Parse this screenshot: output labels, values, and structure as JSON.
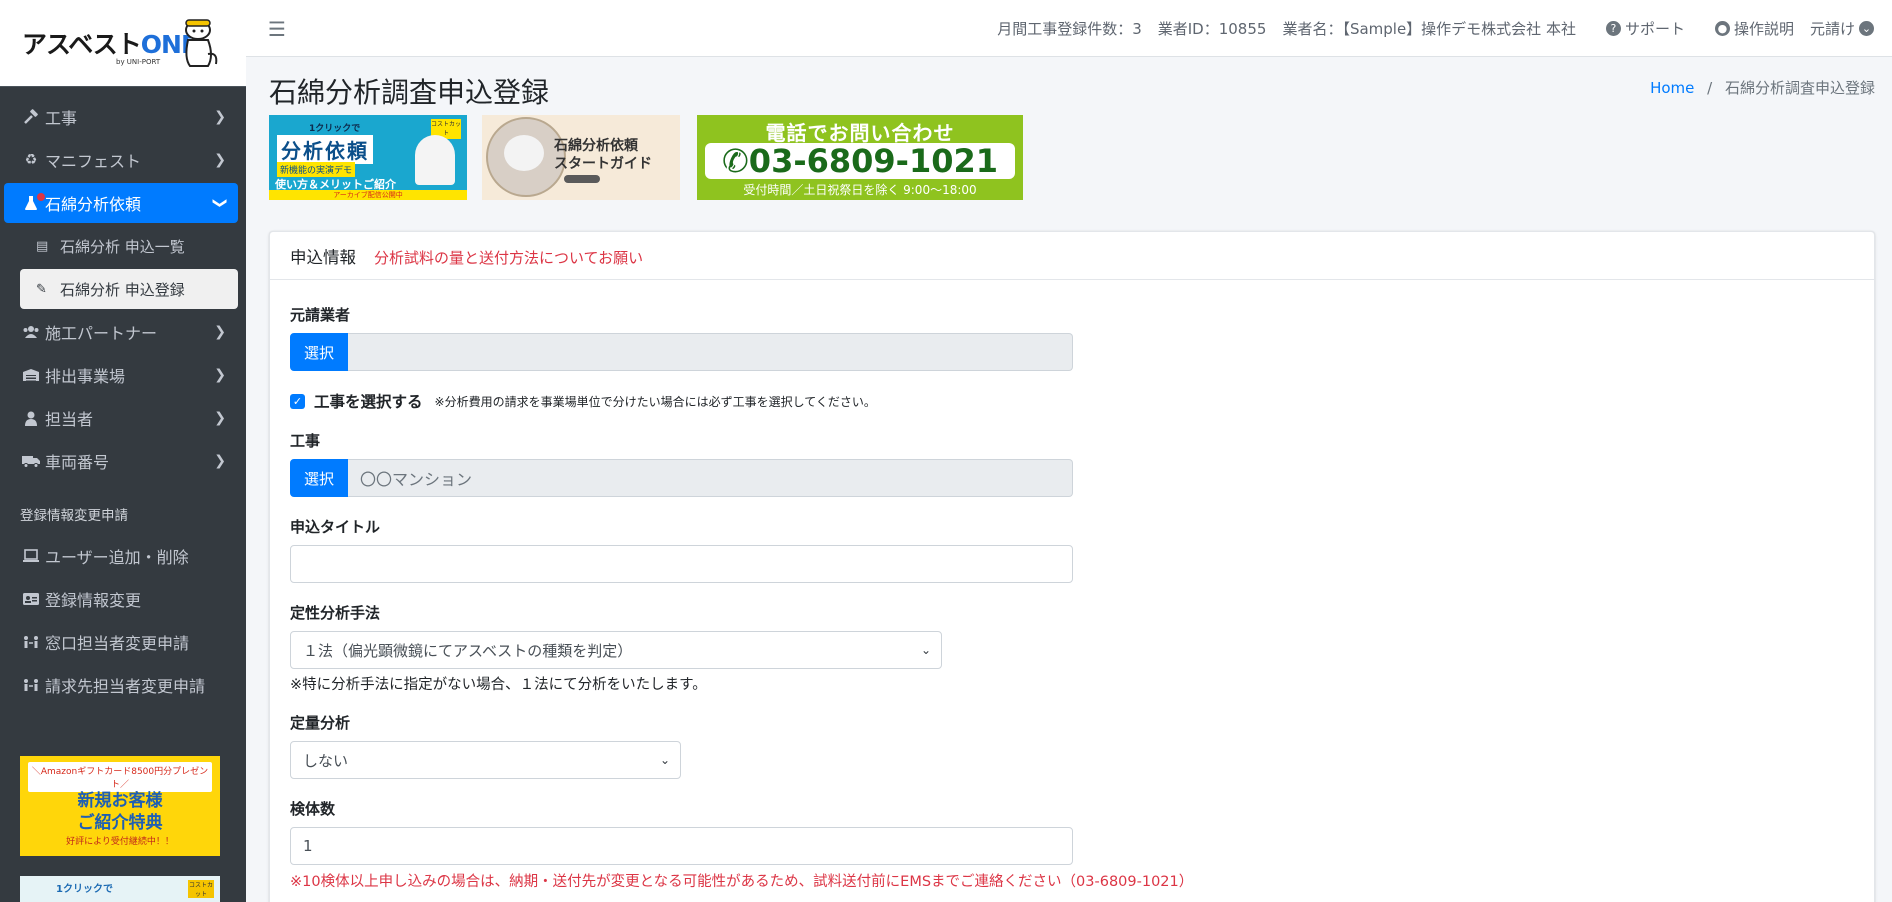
{
  "brand": {
    "name_a": "アスベスト",
    "name_b": "ONE",
    "byline": "by UNI-PORT"
  },
  "sidebar": {
    "items": [
      {
        "label": "工事",
        "icon": "hammer-icon"
      },
      {
        "label": "マニフェスト",
        "icon": "recycle-icon"
      },
      {
        "label": "石綿分析依頼",
        "icon": "flask-icon"
      },
      {
        "label": "施工パートナー",
        "icon": "users-icon"
      },
      {
        "label": "排出事業場",
        "icon": "warehouse-icon"
      },
      {
        "label": "担当者",
        "icon": "user-icon"
      },
      {
        "label": "車両番号",
        "icon": "truck-icon"
      }
    ],
    "subitems": [
      {
        "label": "石綿分析 申込一覧",
        "icon": "list-icon"
      },
      {
        "label": "石綿分析 申込登録",
        "icon": "edit-icon"
      }
    ],
    "section_header": "登録情報変更申請",
    "section_items": [
      {
        "label": "ユーザー追加・削除",
        "icon": "laptop-icon"
      },
      {
        "label": "登録情報変更",
        "icon": "id-card-icon"
      },
      {
        "label": "窓口担当者変更申請",
        "icon": "people-arrows-icon"
      },
      {
        "label": "請求先担当者変更申請",
        "icon": "people-arrows-icon"
      }
    ],
    "banner1": {
      "line1": "＼Amazonギフトカード8500円分プレゼント／",
      "line2": "新規お客様",
      "line3": "ご紹介特典",
      "line4": "好評により受付継続中！！"
    },
    "banner2": {
      "text": "1クリックで",
      "badge": "コストカット"
    }
  },
  "topbar": {
    "monthly_count": "月間工事登録件数：3",
    "vendor_id": "業者ID：10855",
    "vendor_name": "業者名：【Sample】操作デモ株式会社 本社",
    "support": "サポート",
    "manual": "操作説明",
    "role": "元請け"
  },
  "page": {
    "title": "石綿分析調査申込登録",
    "breadcrumb_home": "Home",
    "breadcrumb_current": "石綿分析調査申込登録"
  },
  "banners": {
    "b1": {
      "top": "1クリックで",
      "main": "分析依頼",
      "sub": "新機能の実演デモ",
      "desc": "使い方＆メリットご紹介",
      "footer": "アーカイブ配信公開中",
      "badge": "コストカット"
    },
    "b2": {
      "title1": "石綿分析依頼",
      "title2": "スタートガイド"
    },
    "b3": {
      "title": "電話でお問い合わせ",
      "phone": "03-6809-1021",
      "hours": "受付時間／土日祝祭日を除く 9:00〜18:00"
    }
  },
  "form": {
    "header_title": "申込情報",
    "header_link": "分析試料の量と送付方法についてお願い",
    "prime_label": "元請業者",
    "select_btn": "選択",
    "prime_value": "",
    "check_label": "工事を選択する",
    "check_note": "※分析費用の請求を事業場単位で分けたい場合には必ず工事を選択してください。",
    "koji_label": "工事",
    "koji_placeholder": "〇〇マンション",
    "title_label": "申込タイトル",
    "title_value": "",
    "method_label": "定性分析手法",
    "method_value": "１法（偏光顕微鏡にてアスベストの種類を判定）",
    "method_note": "※特に分析手法に指定がない場合、１法にて分析をいたします。",
    "quant_label": "定量分析",
    "quant_value": "しない",
    "count_label": "検体数",
    "count_value": "1",
    "count_warning": "※10検体以上申し込みの場合は、納期・送付先が変更となる可能性があるため、試料送付前にEMSまでご連絡ください（03-6809-1021）"
  }
}
